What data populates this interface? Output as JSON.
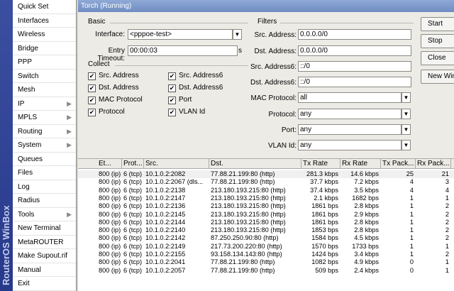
{
  "sidebar": {
    "brand": "RouterOS WinBox",
    "items": [
      {
        "label": "Quick Set",
        "arrow": false
      },
      {
        "label": "Interfaces",
        "arrow": false
      },
      {
        "label": "Wireless",
        "arrow": false
      },
      {
        "label": "Bridge",
        "arrow": false
      },
      {
        "label": "PPP",
        "arrow": false
      },
      {
        "label": "Switch",
        "arrow": false
      },
      {
        "label": "Mesh",
        "arrow": false
      },
      {
        "label": "IP",
        "arrow": true
      },
      {
        "label": "MPLS",
        "arrow": true
      },
      {
        "label": "Routing",
        "arrow": true
      },
      {
        "label": "System",
        "arrow": true
      },
      {
        "label": "Queues",
        "arrow": false
      },
      {
        "label": "Files",
        "arrow": false
      },
      {
        "label": "Log",
        "arrow": false
      },
      {
        "label": "Radius",
        "arrow": false
      },
      {
        "label": "Tools",
        "arrow": true
      },
      {
        "label": "New Terminal",
        "arrow": false
      },
      {
        "label": "MetaROUTER",
        "arrow": false
      },
      {
        "label": "Make Supout.rif",
        "arrow": false
      },
      {
        "label": "Manual",
        "arrow": false
      },
      {
        "label": "Exit",
        "arrow": false
      }
    ]
  },
  "window": {
    "title": "Torch (Running)",
    "basic": {
      "group_label": "Basic",
      "interface_label": "Interface:",
      "interface_value": "<pppoe-test>",
      "entry_timeout_label": "Entry Timeout:",
      "entry_timeout_value": "00:00:03",
      "unit": "s"
    },
    "collect": {
      "group_label": "Collect",
      "items": [
        {
          "label": "Src. Address",
          "checked": true
        },
        {
          "label": "Src. Address6",
          "checked": true
        },
        {
          "label": "Dst. Address",
          "checked": true
        },
        {
          "label": "Dst. Address6",
          "checked": true
        },
        {
          "label": "MAC Protocol",
          "checked": true
        },
        {
          "label": "Port",
          "checked": true
        },
        {
          "label": "Protocol",
          "checked": true
        },
        {
          "label": "VLAN Id",
          "checked": true
        }
      ]
    },
    "filters": {
      "group_label": "Filters",
      "src_address_label": "Src. Address:",
      "src_address_value": "0.0.0.0/0",
      "dst_address_label": "Dst. Address:",
      "dst_address_value": "0.0.0.0/0",
      "src_address6_label": "Src. Address6:",
      "src_address6_value": "::/0",
      "dst_address6_label": "Dst. Address6:",
      "dst_address6_value": "::/0",
      "mac_protocol_label": "MAC Protocol:",
      "mac_protocol_value": "all",
      "protocol_label": "Protocol:",
      "protocol_value": "any",
      "port_label": "Port:",
      "port_value": "any",
      "vlan_label": "VLAN Id:",
      "vlan_value": "any"
    },
    "buttons": {
      "start": "Start",
      "stop": "Stop",
      "close": "Close",
      "new_window": "New Window"
    },
    "table": {
      "columns": [
        "Et...",
        "Prot...",
        "Src.",
        "Dst.",
        "Tx Rate",
        "Rx Rate",
        "Tx Pack...",
        "Rx Pack..."
      ],
      "rows": [
        [
          "800 (ip)",
          "6 (tcp)",
          "10.1.0.2:2082",
          "77.88.21.199:80 (http)",
          "281.3 kbps",
          "14.6 kbps",
          "25",
          "21"
        ],
        [
          "800 (ip)",
          "6 (tcp)",
          "10.1.0.2:2067 (dls...",
          "77.88.21.199:80 (http)",
          "37.7 kbps",
          "7.2 kbps",
          "4",
          "3"
        ],
        [
          "800 (ip)",
          "6 (tcp)",
          "10.1.0.2:2138",
          "213.180.193.215:80 (http)",
          "37.4 kbps",
          "3.5 kbps",
          "4",
          "4"
        ],
        [
          "800 (ip)",
          "6 (tcp)",
          "10.1.0.2:2147",
          "213.180.193.215:80 (http)",
          "2.1 kbps",
          "1682 bps",
          "1",
          "1"
        ],
        [
          "800 (ip)",
          "6 (tcp)",
          "10.1.0.2:2136",
          "213.180.193.215:80 (http)",
          "1861 bps",
          "2.8 kbps",
          "1",
          "2"
        ],
        [
          "800 (ip)",
          "6 (tcp)",
          "10.1.0.2:2145",
          "213.180.193.215:80 (http)",
          "1861 bps",
          "2.9 kbps",
          "1",
          "2"
        ],
        [
          "800 (ip)",
          "6 (tcp)",
          "10.1.0.2:2144",
          "213.180.193.215:80 (http)",
          "1861 bps",
          "2.8 kbps",
          "1",
          "2"
        ],
        [
          "800 (ip)",
          "6 (tcp)",
          "10.1.0.2:2140",
          "213.180.193.215:80 (http)",
          "1853 bps",
          "2.8 kbps",
          "1",
          "2"
        ],
        [
          "800 (ip)",
          "6 (tcp)",
          "10.1.0.2:2142",
          "87.250.250.90:80 (http)",
          "1584 bps",
          "4.5 kbps",
          "1",
          "2"
        ],
        [
          "800 (ip)",
          "6 (tcp)",
          "10.1.0.2:2149",
          "217.73.200.220:80 (http)",
          "1570 bps",
          "1733 bps",
          "1",
          "1"
        ],
        [
          "800 (ip)",
          "6 (tcp)",
          "10.1.0.2:2155",
          "93.158.134.143:80 (http)",
          "1424 bps",
          "3.4 kbps",
          "1",
          "2"
        ],
        [
          "800 (ip)",
          "6 (tcp)",
          "10.1.0.2:2041",
          "77.88.21.199:80 (http)",
          "1082 bps",
          "4.9 kbps",
          "0",
          "1"
        ],
        [
          "800 (ip)",
          "6 (tcp)",
          "10.1.0.2:2057",
          "77.88.21.199:80 (http)",
          "509 bps",
          "2.4 kbps",
          "0",
          "1"
        ]
      ]
    }
  }
}
